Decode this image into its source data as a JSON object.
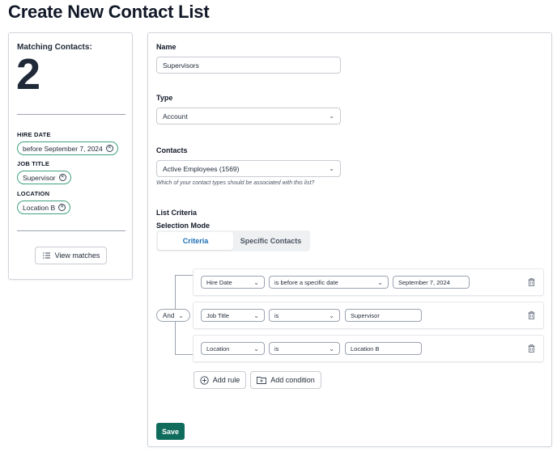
{
  "page": {
    "title": "Create New Contact List"
  },
  "summary": {
    "heading": "Matching Contacts:",
    "count": "2",
    "filters": [
      {
        "label": "HIRE DATE",
        "value": "before September 7, 2024"
      },
      {
        "label": "JOB TITLE",
        "value": "Supervisor"
      },
      {
        "label": "LOCATION",
        "value": "Location B"
      }
    ],
    "view_matches_label": "View matches"
  },
  "form": {
    "name": {
      "label": "Name",
      "value": "Supervisors"
    },
    "type": {
      "label": "Type",
      "value": "Account"
    },
    "contacts": {
      "label": "Contacts",
      "value": "Active Employees (1569)",
      "helper": "Which of your contact types should be associated with this list?"
    },
    "criteria": {
      "heading": "List Criteria",
      "mode_label": "Selection Mode",
      "tabs": [
        {
          "label": "Criteria",
          "active": true
        },
        {
          "label": "Specific Contacts",
          "active": false
        }
      ],
      "logic": "And",
      "rules": [
        {
          "field": "Hire Date",
          "operator": "is before a specific date",
          "value": "September 7, 2024"
        },
        {
          "field": "Job Title",
          "operator": "is",
          "value": "Supervisor"
        },
        {
          "field": "Location",
          "operator": "is",
          "value": "Location B"
        }
      ],
      "add_rule_label": "Add rule",
      "add_condition_label": "Add condition"
    },
    "save_label": "Save"
  },
  "colors": {
    "accent": "#0f6b5c",
    "chip_border": "#3fa17f",
    "active_tab": "#1d6fb8"
  }
}
